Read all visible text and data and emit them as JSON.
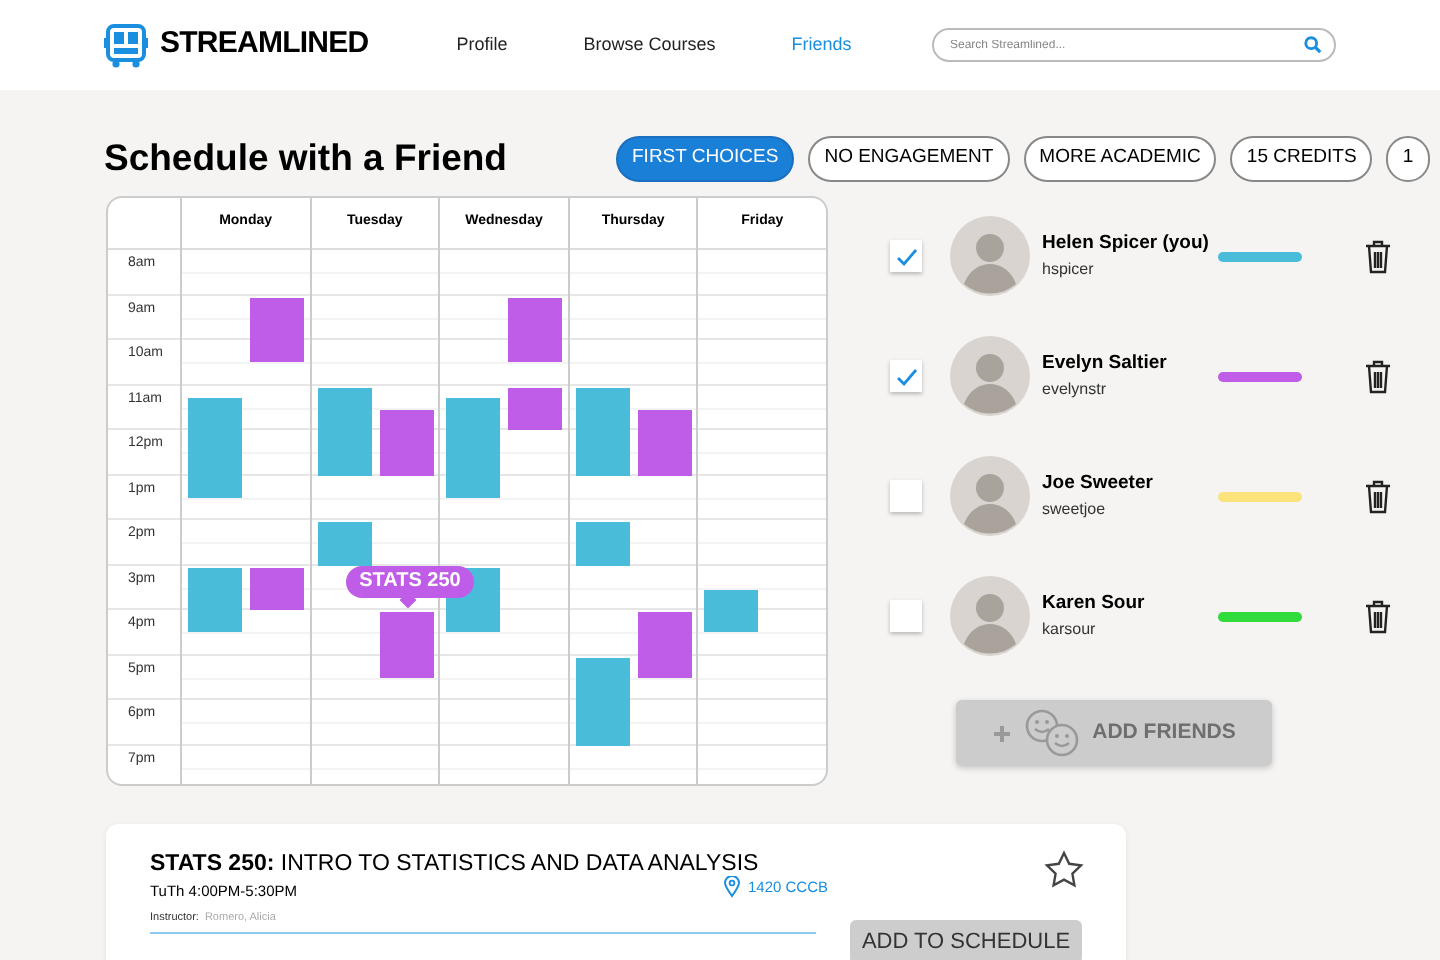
{
  "header": {
    "brand": "STREAMLINED",
    "nav": [
      {
        "label": "Profile",
        "selected": false
      },
      {
        "label": "Browse Courses",
        "selected": false
      },
      {
        "label": "Friends",
        "selected": true
      }
    ],
    "search": {
      "placeholder": "Search Streamlined..."
    }
  },
  "title": "Schedule with a Friend",
  "filters": [
    {
      "label": "FIRST CHOICES",
      "selected": true
    },
    {
      "label": "NO ENGAGEMENT",
      "selected": false
    },
    {
      "label": "MORE ACADEMIC",
      "selected": false
    },
    {
      "label": "15 CREDITS",
      "selected": false
    },
    {
      "label": "1",
      "selected": false
    }
  ],
  "calendar": {
    "times": [
      "8am",
      "9am",
      "10am",
      "11am",
      "12pm",
      "1pm",
      "2pm",
      "3pm",
      "4pm",
      "5pm",
      "6pm",
      "7pm"
    ],
    "days": [
      {
        "name": "Monday",
        "lanes": [
          {
            "events": [
              {
                "color": "#48bcd9"
              },
              {
                "color": "#48bcd9"
              }
            ]
          },
          {
            "events": [
              {
                "color": "#c05de8"
              },
              {
                "color": "#c05de8"
              }
            ]
          }
        ]
      },
      {
        "name": "Tuesday",
        "lanes": [
          {
            "events": [
              {
                "color": "#48bcd9"
              },
              {
                "color": "#48bcd9"
              }
            ]
          },
          {
            "events": [
              {
                "color": "#c05de8"
              },
              {
                "color": "#c05de8",
                "label": "STATS 250"
              }
            ]
          }
        ]
      },
      {
        "name": "Wednesday",
        "lanes": [
          {
            "events": [
              {
                "color": "#48bcd9"
              },
              {
                "color": "#48bcd9"
              }
            ]
          },
          {
            "events": [
              {
                "color": "#c05de8"
              },
              {
                "color": "#c05de8"
              }
            ]
          }
        ]
      },
      {
        "name": "Thursday",
        "lanes": [
          {
            "events": [
              {
                "color": "#48bcd9"
              },
              {
                "color": "#48bcd9"
              },
              {
                "color": "#48bcd9"
              }
            ]
          },
          {
            "events": [
              {
                "color": "#c05de8"
              },
              {
                "color": "#c05de8"
              }
            ]
          }
        ]
      },
      {
        "name": "Friday",
        "lanes": [
          {
            "events": [
              {
                "color": "#48bcd9"
              }
            ]
          }
        ]
      }
    ]
  },
  "friends": [
    {
      "name": "Helen Spicer (you)",
      "username": "hspicer",
      "checked": true,
      "color": "#48bcd9"
    },
    {
      "name": "Evelyn Saltier",
      "username": "evelynstr",
      "checked": true,
      "color": "#c05de8"
    },
    {
      "name": "Joe Sweeter",
      "username": "sweetjoe",
      "checked": false,
      "color": "#fbe27a"
    },
    {
      "name": "Karen Sour",
      "username": "karsour",
      "checked": false,
      "color": "#2fdc3c"
    }
  ],
  "add_friends": {
    "label": "ADD FRIENDS",
    "disabled": true
  },
  "course": {
    "title": "**STATS 250:** INTRO TO STATISTICS AND DATA ANALYSIS",
    "time": "TuTh 4:00PM-5:30PM",
    "location": "1420 CCCB",
    "instructor_label": "Instructor:",
    "instructor": "Romero, Alicia",
    "starred": false,
    "button": "ADD TO SCHEDULE"
  }
}
